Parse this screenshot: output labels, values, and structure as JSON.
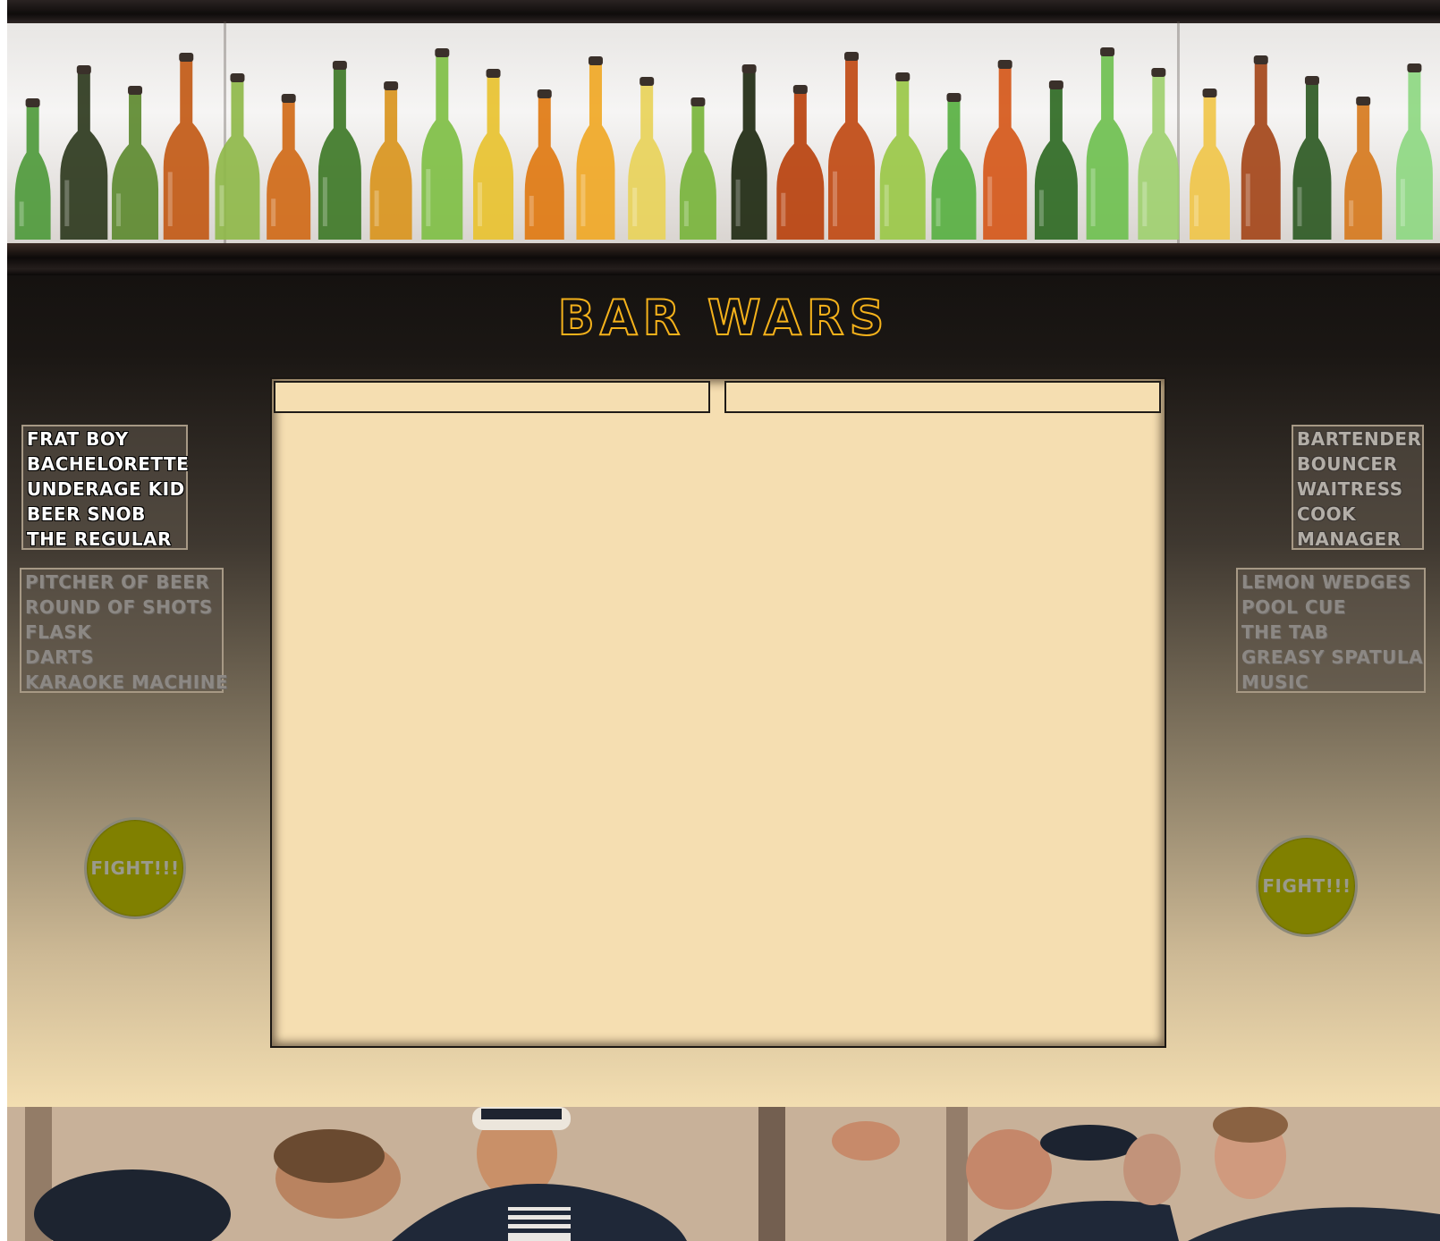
{
  "title": "BAR WARS",
  "colors": {
    "title_outline": "#f5b21b",
    "fight_button": "#808000",
    "arena_fill": "#f5deb1"
  },
  "patrons": {
    "characters": [
      "Frat Boy",
      "Bachelorette",
      "Underage Kid",
      "Beer Snob",
      "The Regular"
    ],
    "items": [
      "Pitcher of Beer",
      "Round of Shots",
      "Flask",
      "Darts",
      "Karaoke Machine"
    ],
    "fight_label": "FIGHT!!!"
  },
  "staff": {
    "characters": [
      "Bartender",
      "Bouncer",
      "Waitress",
      "Cook",
      "Manager"
    ],
    "items": [
      "Lemon Wedges",
      "Pool Cue",
      "The Tab",
      "Greasy Spatula",
      "Music"
    ],
    "fight_label": "FIGHT!!!"
  },
  "arena": {
    "left_fighter": "",
    "right_fighter": ""
  }
}
